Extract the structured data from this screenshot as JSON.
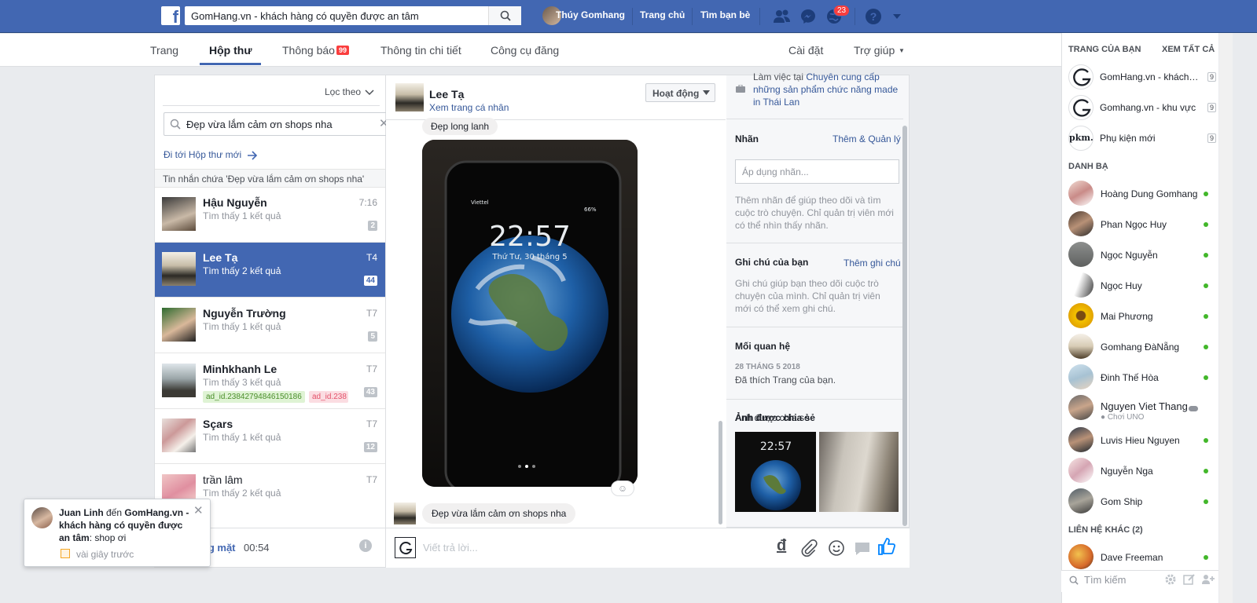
{
  "topbar": {
    "logo_letter": "f",
    "search_value": "GomHang.vn - khách hàng có quyền được an tâm",
    "user_name": "Thúy Gomhang",
    "home_label": "Trang chủ",
    "find_friends_label": "Tìm bạn bè",
    "notification_count": "23",
    "brand_color": "#4267b2"
  },
  "subnav": {
    "tabs": [
      {
        "label": "Trang"
      },
      {
        "label": "Hộp thư"
      },
      {
        "label": "Thông báo"
      },
      {
        "label": "Thông tin chi tiết"
      },
      {
        "label": "Công cụ đăng"
      }
    ],
    "active_tab": "Hộp thư",
    "notifications_badge": "99",
    "settings_label": "Cài đặt",
    "help_label": "Trợ giúp"
  },
  "inbox": {
    "filter_label": "Lọc theo",
    "search_value": "Đẹp vừa lắm cảm ơn shops nha",
    "goto_new_label": "Đi tới Hộp thư mới",
    "search_note": "Tin nhắn chứa 'Đẹp vừa lắm cảm ơn shops nha'",
    "conversations": [
      {
        "name": "Hậu Nguyễn",
        "sub": "Tìm thấy 1 kết quả",
        "time": "7:16",
        "count": "2"
      },
      {
        "name": "Lee Tạ",
        "sub": "Tìm thấy 2 kết quả",
        "time": "T4",
        "count": "44"
      },
      {
        "name": "Nguyễn Trường",
        "sub": "Tìm thấy 1 kết quả",
        "time": "T7",
        "count": "5"
      },
      {
        "name": "Minhkhanh Le",
        "sub": "Tìm thấy 3 kết quả",
        "time": "T7",
        "count": "43",
        "tags": [
          "ad_id.23842794846150186",
          "ad_id.238"
        ]
      },
      {
        "name": "Sçars",
        "sub": "Tìm thấy 1 kết quả",
        "time": "T7",
        "count": "12"
      },
      {
        "name": "trần lâm",
        "sub": "Tìm thấy 2 kết quả",
        "time": "T7"
      }
    ],
    "footer": {
      "status_label": "Vắng mặt",
      "time": "00:54"
    }
  },
  "chat": {
    "name": "Lee Tạ",
    "profile_link": "Xem trang cá nhân",
    "activity_label": "Hoạt động",
    "messages": [
      {
        "text": "Đẹp long lanh"
      },
      {
        "text": "Đẹp vừa lắm cảm ơn shops nha"
      }
    ],
    "photo": {
      "carrier": "Viettel",
      "battery": "66%",
      "time": "22:57",
      "date": "Thứ Tư, 30 tháng 5"
    },
    "composer_placeholder": "Viết trả lời...",
    "currency_symbol": "đ"
  },
  "info": {
    "work_text": "Làm việc tại",
    "work_link": "Chuyên cung cấp những sản phẩm chức năng made in Thái Lan",
    "labels_title": "Nhãn",
    "labels_link": "Thêm & Quản lý",
    "labels_placeholder": "Áp dụng nhãn...",
    "labels_desc": "Thêm nhãn để giúp theo dõi và tìm cuộc trò chuyện. Chỉ quản trị viên mới có thể nhìn thấy nhãn.",
    "notes_title": "Ghi chú của bạn",
    "notes_link": "Thêm ghi chú",
    "notes_desc": "Ghi chú giúp bạn theo dõi cuộc trò chuyện của mình. Chỉ quản trị viên mới có thể xem ghi chú.",
    "relation_title": "Mối quan hệ",
    "relation_date": "28 THÁNG 5 2018",
    "relation_text": "Đã thích Trang của bạn.",
    "shared_title": "Ảnh được chia sẻ",
    "shared_thumb_time": "22:57"
  },
  "sidebar": {
    "pages_header": "TRANG CỦA BẠN",
    "see_all": "XEM TẤT CẢ",
    "pages": [
      {
        "name": "GomHang.vn - khách hàng",
        "count": "9"
      },
      {
        "name": "Gomhang.vn - khu vực",
        "count": "9"
      },
      {
        "name": "Phụ kiện mới",
        "count": "9",
        "logo": "pkm."
      }
    ],
    "contacts_header": "DANH BẠ",
    "contacts": [
      {
        "name": "Hoàng Dung Gomhang"
      },
      {
        "name": "Phan Ngọc Huy"
      },
      {
        "name": "Ngọc Nguyễn"
      },
      {
        "name": "Ngọc Huy"
      },
      {
        "name": "Mai Phương"
      },
      {
        "name": "Gomhang ĐàNẵng"
      },
      {
        "name": "Đinh Thế Hòa"
      },
      {
        "name": "Nguyen Viet Thang",
        "sub": "Chơi UNO"
      },
      {
        "name": "Luvis Hieu Nguyen"
      },
      {
        "name": "Nguyễn Nga"
      },
      {
        "name": "Gom Ship"
      }
    ],
    "other_header": "LIÊN HỆ KHÁC (2)",
    "other_contacts": [
      {
        "name": "Dave Freeman"
      }
    ],
    "search_placeholder": "Tìm kiếm",
    "online_color": "#42b72a"
  },
  "toast": {
    "name": "Juan Linh",
    "middle": " đến ",
    "page": "GomHang.vn - khách hàng có quyền được an tâm",
    "message": ": shop ơi",
    "time": "vài giây trước"
  }
}
